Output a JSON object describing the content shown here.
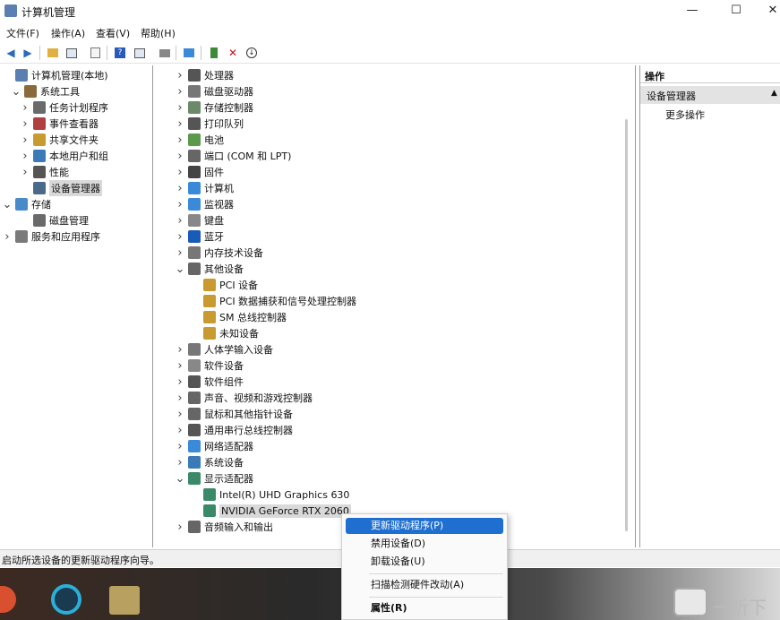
{
  "window": {
    "title": "计算机管理",
    "controls": {
      "minimize": "—",
      "maximize": "☐",
      "close": "✕"
    }
  },
  "menubar": [
    "文件(F)",
    "操作(A)",
    "查看(V)",
    "帮助(H)"
  ],
  "left_tree": [
    {
      "label": "计算机管理(本地)",
      "level": 0,
      "chev": "",
      "icon": "computer-management-icon",
      "color": "#5a7fb0"
    },
    {
      "label": "系统工具",
      "level": 1,
      "chev": "v",
      "icon": "tools-icon",
      "color": "#8a6a3a"
    },
    {
      "label": "任务计划程序",
      "level": 2,
      "chev": ">",
      "icon": "clock-icon",
      "color": "#6a6a6a"
    },
    {
      "label": "事件查看器",
      "level": 2,
      "chev": ">",
      "icon": "event-viewer-icon",
      "color": "#b04040"
    },
    {
      "label": "共享文件夹",
      "level": 2,
      "chev": ">",
      "icon": "shared-folder-icon",
      "color": "#c89a30"
    },
    {
      "label": "本地用户和组",
      "level": 2,
      "chev": ">",
      "icon": "users-icon",
      "color": "#3a7ab8"
    },
    {
      "label": "性能",
      "level": 2,
      "chev": ">",
      "icon": "performance-icon",
      "color": "#555555"
    },
    {
      "label": "设备管理器",
      "level": 2,
      "chev": "",
      "icon": "device-manager-icon",
      "color": "#4a6a8a",
      "selected": true
    },
    {
      "label": "存储",
      "level": 0,
      "chev": "v",
      "icon": "storage-icon",
      "color": "#4a8ac8"
    },
    {
      "label": "磁盘管理",
      "level": 2,
      "chev": "",
      "icon": "disk-management-icon",
      "color": "#6a6a6a"
    },
    {
      "label": "服务和应用程序",
      "level": 0,
      "chev": ">",
      "icon": "services-icon",
      "color": "#7a7a7a"
    }
  ],
  "device_tree": [
    {
      "label": "处理器",
      "level": 0,
      "chev": ">",
      "icon": "processor-icon",
      "color": "#555555"
    },
    {
      "label": "磁盘驱动器",
      "level": 0,
      "chev": ">",
      "icon": "disk-drive-icon",
      "color": "#777777"
    },
    {
      "label": "存储控制器",
      "level": 0,
      "chev": ">",
      "icon": "storage-controller-icon",
      "color": "#6a8a6a"
    },
    {
      "label": "打印队列",
      "level": 0,
      "chev": ">",
      "icon": "printer-icon",
      "color": "#555555"
    },
    {
      "label": "电池",
      "level": 0,
      "chev": ">",
      "icon": "battery-icon",
      "color": "#5a9a4a"
    },
    {
      "label": "端口 (COM 和 LPT)",
      "level": 0,
      "chev": ">",
      "icon": "port-icon",
      "color": "#666666"
    },
    {
      "label": "固件",
      "level": 0,
      "chev": ">",
      "icon": "firmware-icon",
      "color": "#444444"
    },
    {
      "label": "计算机",
      "level": 0,
      "chev": ">",
      "icon": "computer-icon",
      "color": "#3a8ad8"
    },
    {
      "label": "监视器",
      "level": 0,
      "chev": ">",
      "icon": "monitor-icon",
      "color": "#3a8ad8"
    },
    {
      "label": "键盘",
      "level": 0,
      "chev": ">",
      "icon": "keyboard-icon",
      "color": "#888888"
    },
    {
      "label": "蓝牙",
      "level": 0,
      "chev": ">",
      "icon": "bluetooth-icon",
      "color": "#1a5ab8"
    },
    {
      "label": "内存技术设备",
      "level": 0,
      "chev": ">",
      "icon": "memory-device-icon",
      "color": "#777777"
    },
    {
      "label": "其他设备",
      "level": 0,
      "chev": "v",
      "icon": "other-devices-icon",
      "color": "#666666"
    },
    {
      "label": "PCI 设备",
      "level": 1,
      "chev": "",
      "icon": "unknown-device-warning-icon",
      "color": "#c89a30"
    },
    {
      "label": "PCI 数据捕获和信号处理控制器",
      "level": 1,
      "chev": "",
      "icon": "unknown-device-warning-icon",
      "color": "#c89a30"
    },
    {
      "label": "SM 总线控制器",
      "level": 1,
      "chev": "",
      "icon": "unknown-device-warning-icon",
      "color": "#c89a30"
    },
    {
      "label": "未知设备",
      "level": 1,
      "chev": "",
      "icon": "unknown-device-warning-icon",
      "color": "#c89a30"
    },
    {
      "label": "人体学输入设备",
      "level": 0,
      "chev": ">",
      "icon": "hid-icon",
      "color": "#777777"
    },
    {
      "label": "软件设备",
      "level": 0,
      "chev": ">",
      "icon": "software-device-icon",
      "color": "#888888"
    },
    {
      "label": "软件组件",
      "level": 0,
      "chev": ">",
      "icon": "software-component-icon",
      "color": "#555555"
    },
    {
      "label": "声音、视频和游戏控制器",
      "level": 0,
      "chev": ">",
      "icon": "sound-icon",
      "color": "#666666"
    },
    {
      "label": "鼠标和其他指针设备",
      "level": 0,
      "chev": ">",
      "icon": "mouse-icon",
      "color": "#666666"
    },
    {
      "label": "通用串行总线控制器",
      "level": 0,
      "chev": ">",
      "icon": "usb-icon",
      "color": "#555555"
    },
    {
      "label": "网络适配器",
      "level": 0,
      "chev": ">",
      "icon": "network-adapter-icon",
      "color": "#3a8ad8"
    },
    {
      "label": "系统设备",
      "level": 0,
      "chev": ">",
      "icon": "system-device-icon",
      "color": "#3a7ab8"
    },
    {
      "label": "显示适配器",
      "level": 0,
      "chev": "v",
      "icon": "display-adapter-icon",
      "color": "#3a8a6a"
    },
    {
      "label": "Intel(R) UHD Graphics 630",
      "level": 1,
      "chev": "",
      "icon": "display-adapter-icon",
      "color": "#3a8a6a"
    },
    {
      "label": "NVIDIA GeForce RTX 2060",
      "level": 1,
      "chev": "",
      "icon": "display-adapter-icon",
      "color": "#3a8a6a",
      "selected": true
    },
    {
      "label": "音频输入和输出",
      "level": 0,
      "chev": ">",
      "icon": "audio-io-icon",
      "color": "#666666"
    }
  ],
  "actions_pane": {
    "header": "操作",
    "section": "设备管理器",
    "more": "更多操作"
  },
  "context_menu": [
    {
      "label": "更新驱动程序(P)",
      "highlighted": true
    },
    {
      "label": "禁用设备(D)"
    },
    {
      "label": "卸载设备(U)"
    },
    {
      "label": "扫描检测硬件改动(A)",
      "separator_before": true
    },
    {
      "label": "属性(R)",
      "bold": true,
      "separator_before": true
    }
  ],
  "status_bar": "启动所选设备的更新驱动程序向导。",
  "watermark": "一听下"
}
